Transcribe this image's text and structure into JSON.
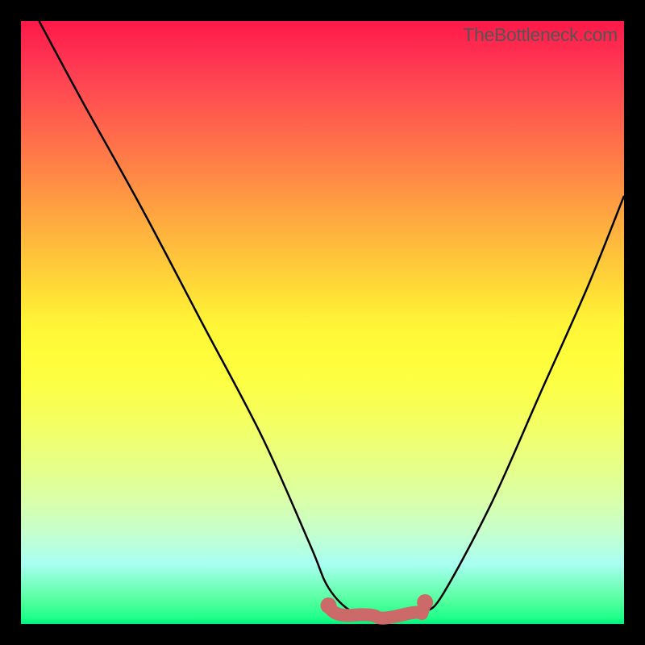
{
  "attribution": "TheBottleneck.com",
  "colors": {
    "frame": "#000000",
    "curve_stroke": "#000000",
    "band_fill": "#cc6a6a",
    "band_stroke": "#cc6a6a"
  },
  "chart_data": {
    "type": "line",
    "title": "",
    "xlabel": "",
    "ylabel": "",
    "xlim": [
      0,
      100
    ],
    "ylim": [
      0,
      100
    ],
    "gradient_stops": [
      {
        "pos": 0,
        "color": "#ff1848"
      },
      {
        "pos": 50,
        "color": "#fff436"
      },
      {
        "pos": 100,
        "color": "#00f07e"
      }
    ],
    "series": [
      {
        "name": "bottleneck-curve",
        "x": [
          3,
          10,
          20,
          30,
          40,
          48,
          51,
          55,
          60,
          64,
          67,
          70,
          78,
          86,
          94,
          100
        ],
        "values": [
          100,
          87,
          69,
          50,
          31,
          13,
          6,
          2,
          1,
          1,
          2,
          5,
          20,
          38,
          56,
          71
        ]
      }
    ],
    "flat_band": {
      "x_start": 51,
      "x_end": 67,
      "y": 2
    }
  }
}
